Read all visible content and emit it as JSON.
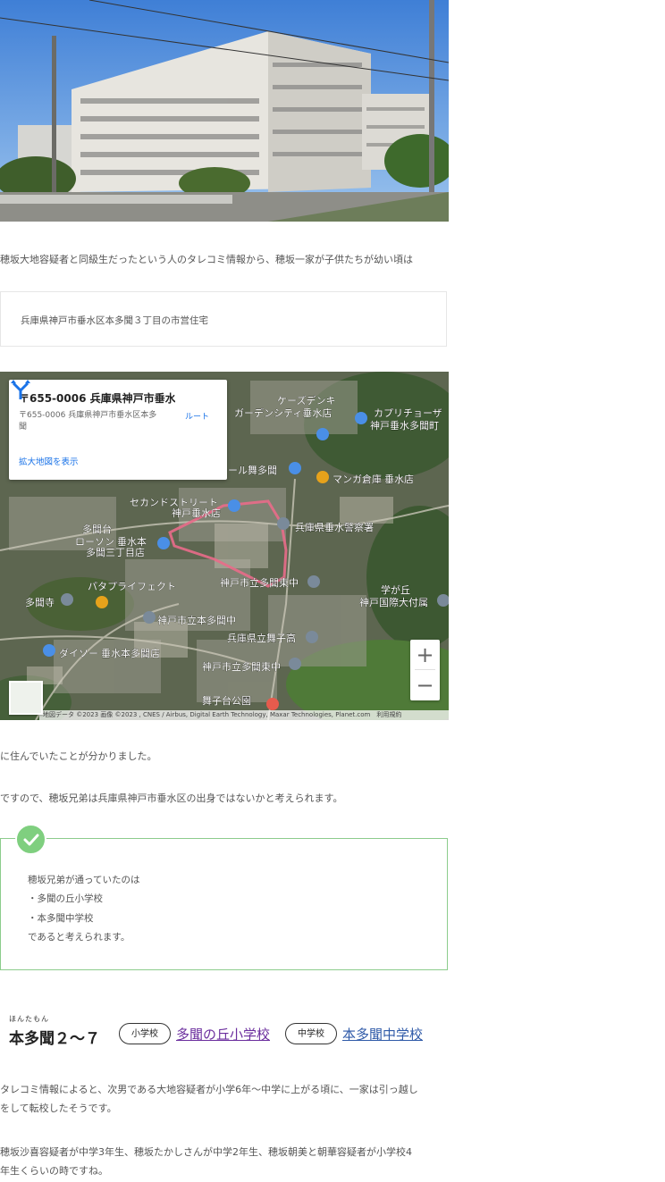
{
  "article": {
    "intro": "穂坂大地容疑者と同級生だったという人のタレコミ情報から、穂坂一家が子供たちが幼い頃は",
    "address": "兵庫県神戸市垂水区本多聞３丁目の市営住宅",
    "after_map_1": "に住んでいたことが分かりました。",
    "after_map_2": "ですので、穂坂兄弟は兵庫県神戸市垂水区の出身ではないかと考えられます。"
  },
  "map": {
    "card_title": "〒655-0006 兵庫県神戸市垂水...",
    "card_address_line1": "〒655-0006 兵庫県神戸市垂水区本多",
    "card_address_line2": "聞",
    "route_label": "ルート",
    "larger_map_link": "拡大地図を表示",
    "zoom_in": "+",
    "zoom_out": "−",
    "attribution": "地図データ ©2023 画像 ©2023 , CNES / Airbus, Digital Earth Technology, Maxar Technologies, Planet.com　利用規約",
    "labels": {
      "l1": "ケーズデンキ",
      "l2": "ガーデンシティ垂水店",
      "l3": "カプリチョーザ",
      "l4": "神戸垂水多聞町",
      "l5": "ブルメール舞多聞",
      "l6": "マンガ倉庫 垂水店",
      "l7": "セカンドストリート",
      "l8": "神戸垂水店",
      "l9": "兵庫県垂水警察署",
      "l10": "多聞台",
      "l11": "ローソン 垂水本",
      "l12": "多聞三丁目店",
      "l13": "パタプライフェクト",
      "l14": "神戸市立多聞東中",
      "l15": "学が丘",
      "l16": "神戸国際大付属",
      "l17": "多聞寺",
      "l18": "神戸市立本多聞中",
      "l19": "兵庫県立舞子高",
      "l20": "ダイソー 垂水本多聞店",
      "l21": "神戸市立多聞東中",
      "l22": "舞子台公園"
    }
  },
  "checkbox": {
    "line1": "穂坂兄弟が通っていたのは",
    "line2": "・多聞の丘小学校",
    "line3": "・本多聞中学校",
    "line4": "であると考えられます。"
  },
  "school_info": {
    "ruby": "ほんたもん",
    "place": "本多聞２〜７",
    "elem_pill": "小学校",
    "elem_name": "多聞の丘小学校",
    "jh_pill": "中学校",
    "jh_name": "本多聞中学校"
  },
  "article2": {
    "p1_line1": "タレコミ情報によると、次男である大地容疑者が小学6年〜中学に上がる頃に、一家は引っ越し",
    "p1_line2": "をして転校したそうです。",
    "p2_line1": "穂坂沙喜容疑者が中学3年生、穂坂たかしさんが中学2年生、穂坂朝美と朝華容疑者が小学校4",
    "p2_line2": "年生くらいの時ですね。"
  },
  "colors": {
    "link": "#2f5aa8",
    "visited_link": "#6b2e9e",
    "check_green": "#7fcf7f",
    "map_route": "#e96c8a"
  }
}
